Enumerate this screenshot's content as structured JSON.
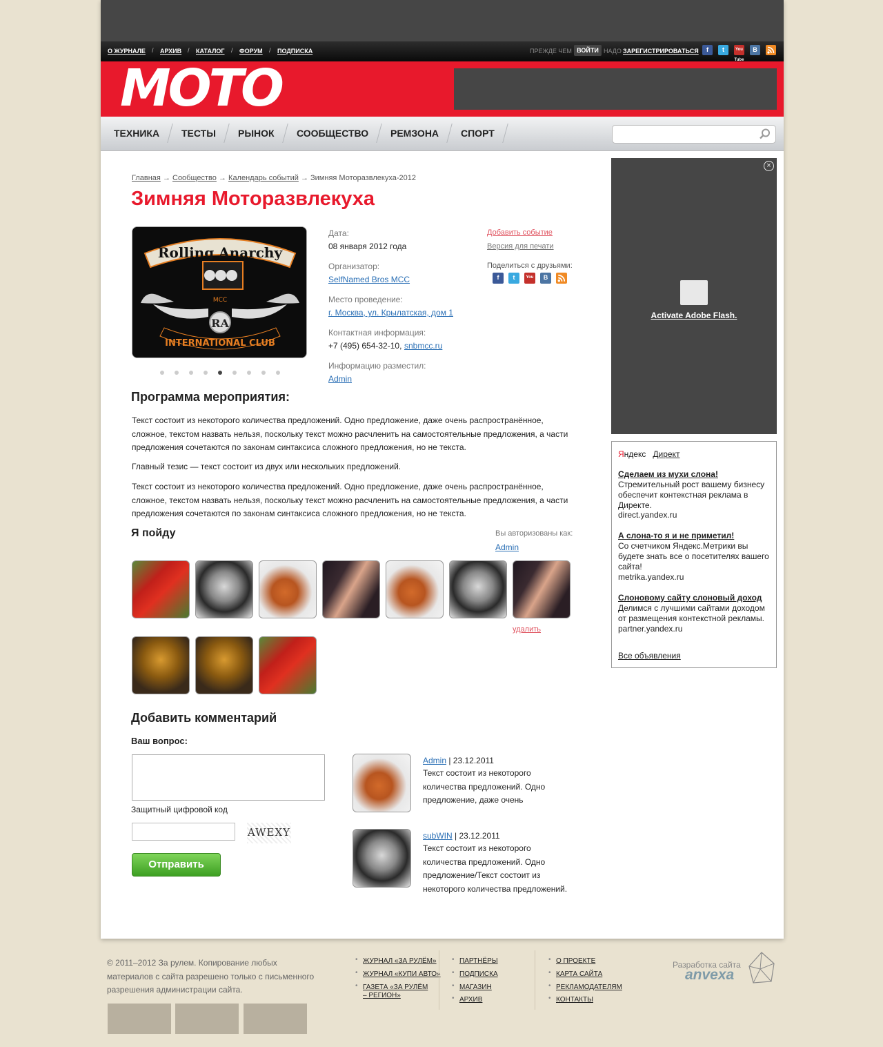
{
  "top_nav": {
    "links": [
      "О ЖУРНАЛЕ",
      "АРХИВ",
      "КАТАЛОГ",
      "ФОРУМ",
      "ПОДПИСКА"
    ],
    "before_text": "ПРЕЖДЕ ЧЕМ",
    "login": "ВОЙТИ",
    "need_text": "НАДО",
    "register": "ЗАРЕГИСТРИРОВАТЬСЯ",
    "social": [
      "f",
      "t",
      "You Tube",
      "B",
      "rss"
    ]
  },
  "logo": "MOTO",
  "main_nav": [
    "ТЕХНИКА",
    "ТЕСТЫ",
    "РЫНОК",
    "СООБЩЕСТВО",
    "РЕМЗОНА",
    "СПОРТ"
  ],
  "search": {
    "placeholder": ""
  },
  "breadcrumb": {
    "items": [
      "Главная",
      "Сообщество",
      "Календарь событий"
    ],
    "sep": "→",
    "current": "Зимняя Моторазвлекуха-2012"
  },
  "page_title": "Зимняя Моторазвлекуха",
  "event_image": {
    "top_text": "Rolling Anarchy",
    "bottom_text": "INTERNATIONAL CLUB",
    "center_text": "RA",
    "badge": "MCC"
  },
  "gallery_dots": {
    "count": 9,
    "active_index": 4
  },
  "info": {
    "date_label": "Дата:",
    "date_value": "08 января 2012 года",
    "org_label": "Организатор:",
    "org_value": "SelfNamed Bros MCC",
    "place_label": "Место проведение:",
    "place_value": "г. Москва, ул. Крылатская, дом 1",
    "contact_label": "Контактная информация:",
    "contact_phone": "+7 (495) 654-32-10,",
    "contact_site": "snbmcc.ru",
    "posted_label": "Информацию разместил:",
    "posted_value": "Admin"
  },
  "side_links": {
    "add_event": "Добавить событие",
    "print": "Версия для печати",
    "share": "Поделиться с друзьями:"
  },
  "program": {
    "title": "Программа мероприятия:",
    "paragraphs": [
      "Текст состоит из некоторого количества предложений. Одно предложение, даже очень распространённое, сложное, текстом назвать нельзя, поскольку текст можно расчленить на самостоятельные предложения, а части предложения сочетаются по законам синтаксиса сложного предложения, но не текста.",
      "Главный тезис — текст состоит из двух или нескольких предложений.",
      "Текст состоит из некоторого количества предложений. Одно предложение, даже очень распространённое, сложное, текстом назвать нельзя, поскольку текст можно расчленить на самостоятельные предложения, а части предложения сочетаются по законам синтаксиса сложного предложения, но не текста."
    ]
  },
  "going": {
    "title": "Я пойду",
    "auth_label": "Вы авторизованы как:",
    "auth_user": "Admin",
    "delete": "удалить",
    "avatars": [
      "parrot",
      "lincoln",
      "squirrel",
      "woman",
      "squirrel",
      "lincoln",
      "woman",
      "statue",
      "statue",
      "parrot"
    ]
  },
  "comment_form": {
    "title": "Добавить комментарий",
    "question_label": "Ваш вопрос:",
    "captcha_label": "Защитный цифровой код",
    "captcha_text": "AWEXY",
    "submit": "Отправить"
  },
  "comments": [
    {
      "author": "Admin",
      "date": "| 23.12.2011",
      "avatar": "squirrel",
      "text": "Текст состоит из некоторого количества предложений. Одно предложение, даже очень"
    },
    {
      "author": "subWIN",
      "date": "| 23.12.2011",
      "avatar": "lincoln",
      "text": "Текст состоит из некоторого количества предложений. Одно предложение/Текст состоит из некоторого количества предложений."
    }
  ],
  "flash": {
    "text": "Activate Adobe Flash."
  },
  "ads": {
    "brand_y": "Я",
    "brand_rest": "ндекс",
    "direct": "Директ",
    "items": [
      {
        "title": "Сделаем из мухи слона!",
        "text": "Стремительный рост вашему бизнесу обеспечит контекстная реклама в Директе.",
        "domain": "direct.yandex.ru"
      },
      {
        "title": "А слона-то я и не приметил!",
        "text": "Со счетчиком Яндекс.Метрики вы будете знать все о посетителях вашего сайта!",
        "domain": "metrika.yandex.ru"
      },
      {
        "title": "Слоновому сайту слоновый доход",
        "text": "Делимся с лучшими сайтами доходом от размещения контекстной рекламы.",
        "domain": "partner.yandex.ru"
      }
    ],
    "all": "Все объявления"
  },
  "footer": {
    "copyright": "© 2011–2012 За рулем. Копирование любых материалов с сайта разрешено только с письменного разрешения администрации сайта.",
    "col1": [
      "ЖУРНАЛ «ЗА РУЛЁМ»",
      "ЖУРНАЛ «КУПИ АВТО»",
      "ГАЗЕТА «ЗА РУЛЁМ – РЕГИОН»"
    ],
    "col2": [
      "ПАРТНЁРЫ",
      "ПОДПИСКА",
      "МАГАЗИН",
      "АРХИВ"
    ],
    "col3": [
      "О ПРОЕКТЕ",
      "КАРТА САЙТА",
      "РЕКЛАМОДАТЕЛЯМ",
      "КОНТАКТЫ"
    ],
    "dev_label": "Разработка сайта",
    "dev_name": "anvexa"
  },
  "colors": {
    "brand_red": "#e8192c",
    "button_green": "#5bbd3a",
    "link_blue": "#2a6fb5"
  }
}
